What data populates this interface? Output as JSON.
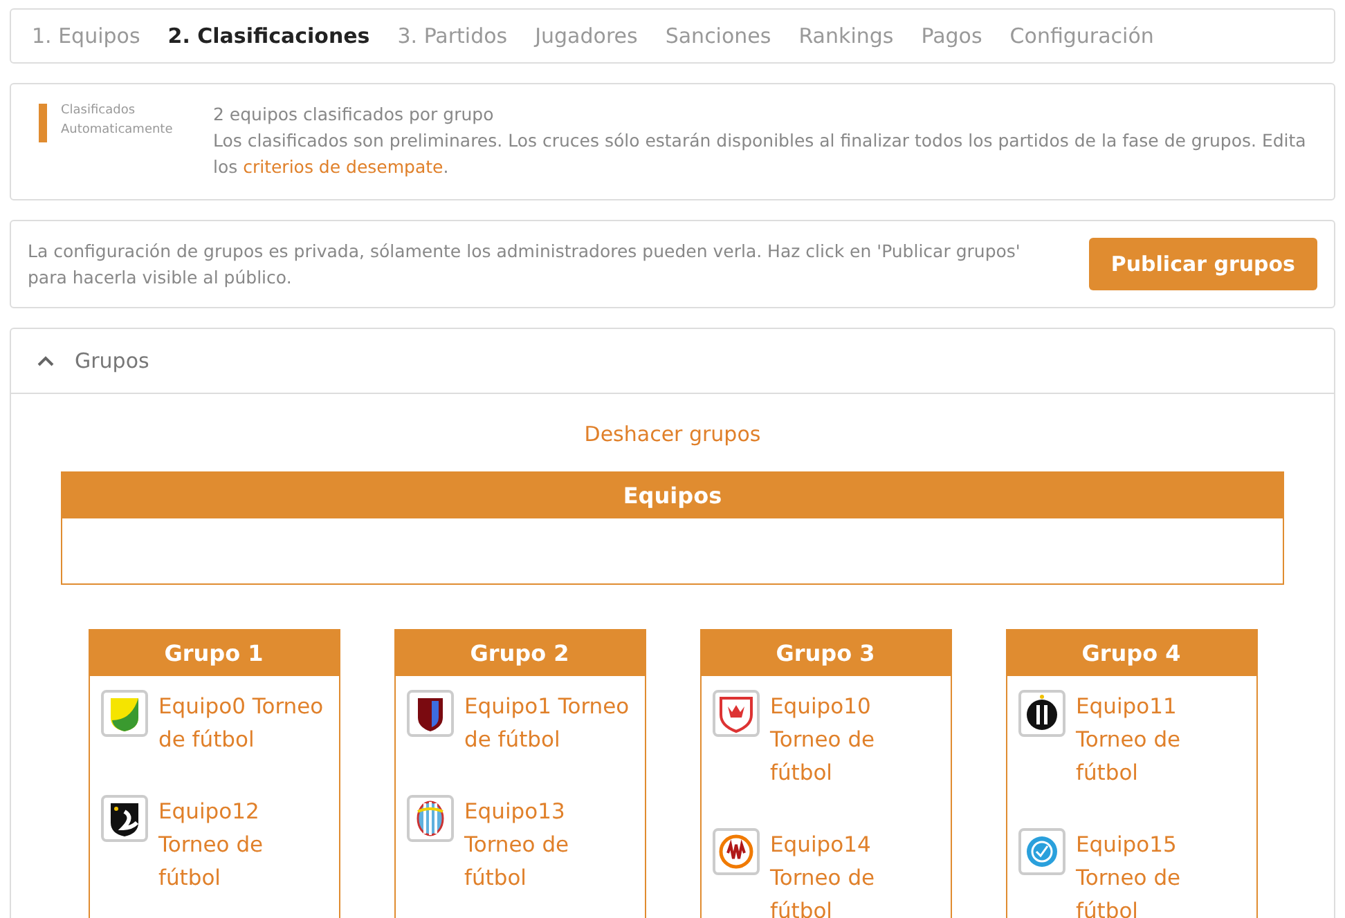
{
  "tabs": [
    {
      "label": "1. Equipos",
      "selected": false
    },
    {
      "label": "2. Clasificaciones",
      "selected": true
    },
    {
      "label": "3. Partidos",
      "selected": false
    },
    {
      "label": "Jugadores",
      "selected": false
    },
    {
      "label": "Sanciones",
      "selected": false
    },
    {
      "label": "Rankings",
      "selected": false
    },
    {
      "label": "Pagos",
      "selected": false
    },
    {
      "label": "Configuración",
      "selected": false
    }
  ],
  "qualify_panel": {
    "label_lines": [
      "Clasificados",
      "Automaticamente"
    ],
    "summary": "2 equipos clasificados por grupo",
    "note": "Los clasificados son preliminares. Los cruces sólo estarán disponibles al finalizar todos los partidos de la fase de grupos. Edita los",
    "link": "criterios de desempate",
    "note_end": "."
  },
  "privacy_panel": {
    "message": "La configuración de grupos es privada, sólamente los administradores pueden verla. Haz click en 'Publicar grupos' para hacerla visible al público.",
    "button": "Publicar grupos"
  },
  "groups_section": {
    "title": "Grupos",
    "expanded": true,
    "undo_link": "Deshacer grupos",
    "pool_title": "Equipos",
    "groups": [
      {
        "title": "Grupo 1",
        "teams": [
          {
            "name": "Equipo0 Torneo de fútbol"
          },
          {
            "name": "Equipo12 Torneo de fútbol"
          }
        ]
      },
      {
        "title": "Grupo 2",
        "teams": [
          {
            "name": "Equipo1 Torneo de fútbol"
          },
          {
            "name": "Equipo13 Torneo de fútbol"
          }
        ]
      },
      {
        "title": "Grupo 3",
        "teams": [
          {
            "name": "Equipo10 Torneo de fútbol"
          },
          {
            "name": "Equipo14 Torneo de fútbol"
          }
        ]
      },
      {
        "title": "Grupo 4",
        "teams": [
          {
            "name": "Equipo11 Torneo de fútbol"
          },
          {
            "name": "Equipo15 Torneo de fútbol"
          }
        ]
      }
    ]
  }
}
